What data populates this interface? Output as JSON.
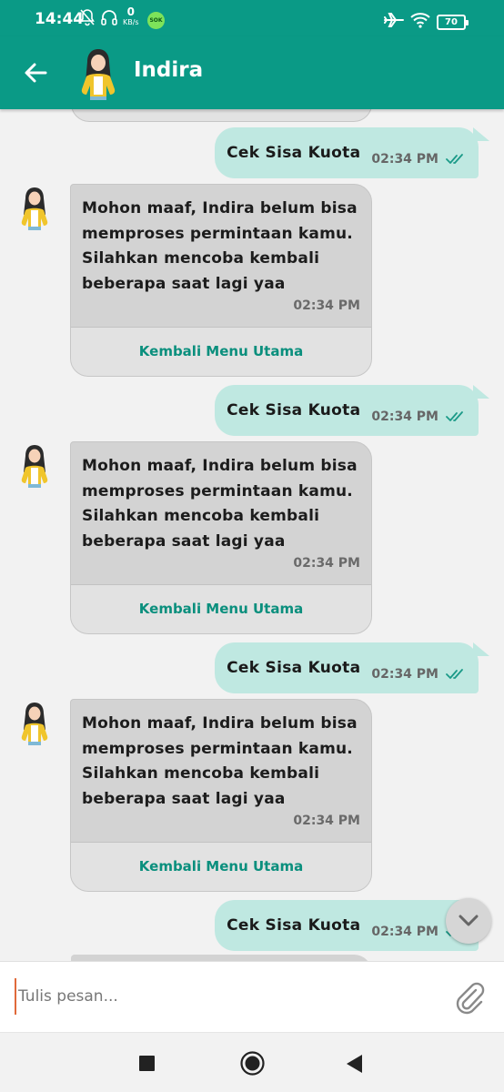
{
  "status_bar": {
    "time": "14:44",
    "net_speed_value": "0",
    "net_speed_unit": "KB/s",
    "badge": "SOK",
    "battery": "70"
  },
  "header": {
    "title": "Indira"
  },
  "messages": [
    {
      "type": "out",
      "text": "Cek Sisa Kuota",
      "time": "02:34 PM"
    },
    {
      "type": "in",
      "text": "Mohon maaf, Indira belum bisa memproses permintaan kamu. Silahkan mencoba kembali beberapa saat lagi yaa",
      "time": "02:34 PM",
      "button": "Kembali Menu Utama"
    },
    {
      "type": "out",
      "text": "Cek Sisa Kuota",
      "time": "02:34 PM"
    },
    {
      "type": "in",
      "text": "Mohon maaf, Indira belum bisa memproses permintaan kamu. Silahkan mencoba kembali beberapa saat lagi yaa",
      "time": "02:34 PM",
      "button": "Kembali Menu Utama"
    },
    {
      "type": "out",
      "text": "Cek Sisa Kuota",
      "time": "02:34 PM"
    },
    {
      "type": "in",
      "text": "Mohon maaf, Indira belum bisa memproses permintaan kamu. Silahkan mencoba kembali beberapa saat lagi yaa",
      "time": "02:34 PM",
      "button": "Kembali Menu Utama"
    },
    {
      "type": "out",
      "text": "Cek Sisa Kuota",
      "time": "02:34 PM"
    }
  ],
  "composer": {
    "placeholder": "Tulis pesan...",
    "value": ""
  },
  "colors": {
    "primary": "#0a9a86",
    "outgoing_bubble": "#bfe8e1",
    "incoming_bubble": "#d3d3d3",
    "button_text": "#0a8f7d"
  },
  "icons": {
    "back": "arrow-left-icon",
    "attach": "paperclip-icon",
    "scroll": "chevron-down-icon",
    "read_receipt": "double-check-icon"
  }
}
